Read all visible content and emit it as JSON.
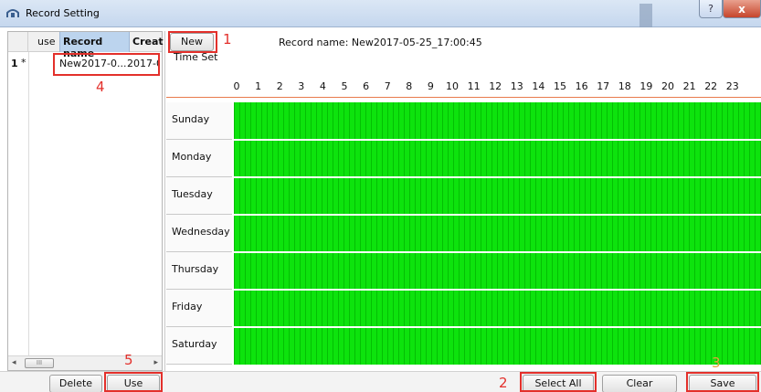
{
  "window": {
    "title": "Record Setting",
    "help_glyph": "?",
    "close_glyph": "x"
  },
  "left_table": {
    "headers": {
      "use": "use",
      "record_name": "Record name",
      "create": "Creat"
    },
    "rows": [
      {
        "num": "1",
        "use": "*",
        "name": "New2017-0...",
        "date": "2017-0"
      }
    ],
    "scroll_thumb": "III",
    "arrow_left": "◂",
    "arrow_right": "▸"
  },
  "buttons": {
    "new": "New",
    "delete": "Delete",
    "use": "Use",
    "select_all": "Select All",
    "clear": "Clear",
    "save": "Save"
  },
  "record_name_label": "Record name: New2017-05-25_17:00:45",
  "time_set_label": "Time Set",
  "hours": [
    "0",
    "1",
    "2",
    "3",
    "4",
    "5",
    "6",
    "7",
    "8",
    "9",
    "10",
    "11",
    "12",
    "13",
    "14",
    "15",
    "16",
    "17",
    "18",
    "19",
    "20",
    "21",
    "22",
    "23"
  ],
  "days": [
    "Sunday",
    "Monday",
    "Tuesday",
    "Wednesday",
    "Thursday",
    "Friday",
    "Saturday"
  ],
  "annotations": [
    "1",
    "2",
    "3",
    "4",
    "5"
  ],
  "colors": {
    "schedule_fill": "#0de30d",
    "highlight": "#e3302b",
    "timeline_line": "#e87a4c"
  }
}
